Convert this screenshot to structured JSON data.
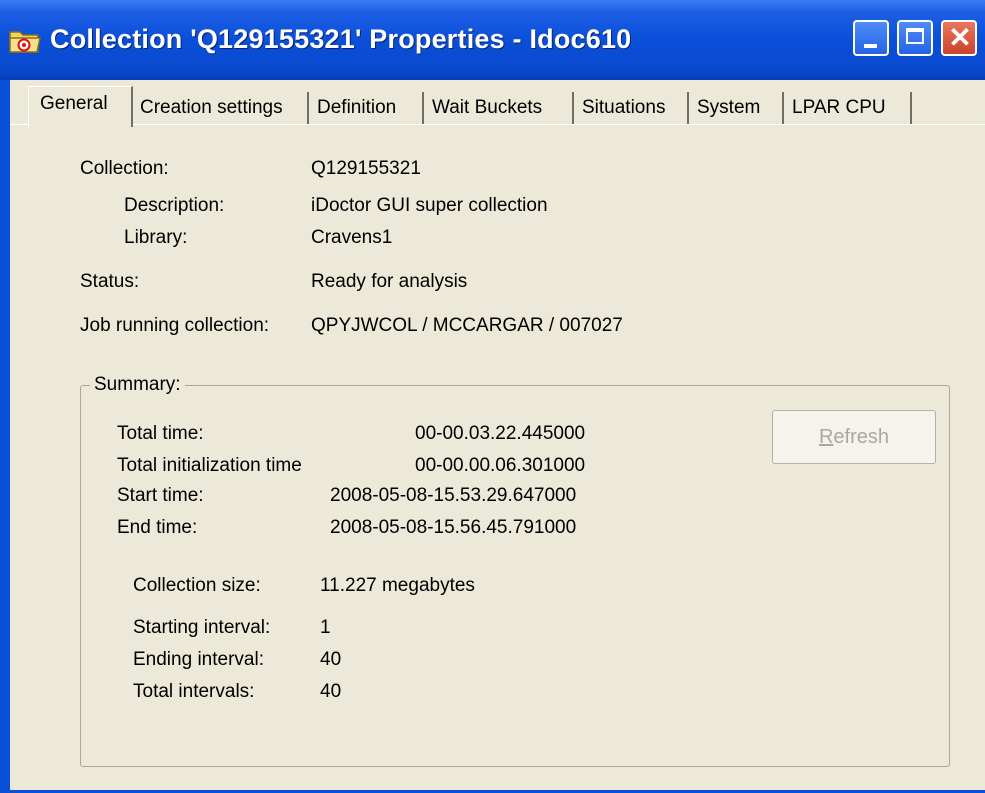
{
  "window": {
    "title": "Collection 'Q129155321' Properties - Idoc610",
    "icon": "folder-collection-icon",
    "controls": {
      "minimize": "minimize",
      "maximize": "maximize",
      "close": "close"
    }
  },
  "tabs": [
    {
      "label": "General",
      "active": true
    },
    {
      "label": "Creation settings",
      "active": false
    },
    {
      "label": "Definition",
      "active": false
    },
    {
      "label": "Wait Buckets",
      "active": false
    },
    {
      "label": "Situations",
      "active": false
    },
    {
      "label": "System",
      "active": false
    },
    {
      "label": "LPAR CPU",
      "active": false
    }
  ],
  "general": {
    "collection_label": "Collection:",
    "collection_value": "Q129155321",
    "description_label": "Description:",
    "description_value": "iDoctor GUI super collection",
    "library_label": "Library:",
    "library_value": "Cravens1",
    "status_label": "Status:",
    "status_value": "Ready for analysis",
    "job_label": "Job running collection:",
    "job_value": "QPYJWCOL / MCCARGAR / 007027"
  },
  "summary": {
    "legend": "Summary:",
    "refresh_label": "Refresh",
    "refresh_enabled": false,
    "total_time_label": "Total time:",
    "total_time_value": "00-00.03.22.445000",
    "init_time_label": "Total initialization time",
    "init_time_value": "00-00.00.06.301000",
    "start_time_label": "Start time:",
    "start_time_value": "2008-05-08-15.53.29.647000",
    "end_time_label": "End time:",
    "end_time_value": "2008-05-08-15.56.45.791000",
    "size_label": "Collection size:",
    "size_value": "11.227 megabytes",
    "start_interval_label": "Starting interval:",
    "start_interval_value": "1",
    "end_interval_label": "Ending interval:",
    "end_interval_value": "40",
    "total_intervals_label": "Total intervals:",
    "total_intervals_value": "40"
  },
  "colors": {
    "titlebar": "#0a4fd8",
    "dialog_bg": "#ece9d8",
    "close_button": "#c9432a",
    "disabled_text": "#aca899"
  }
}
